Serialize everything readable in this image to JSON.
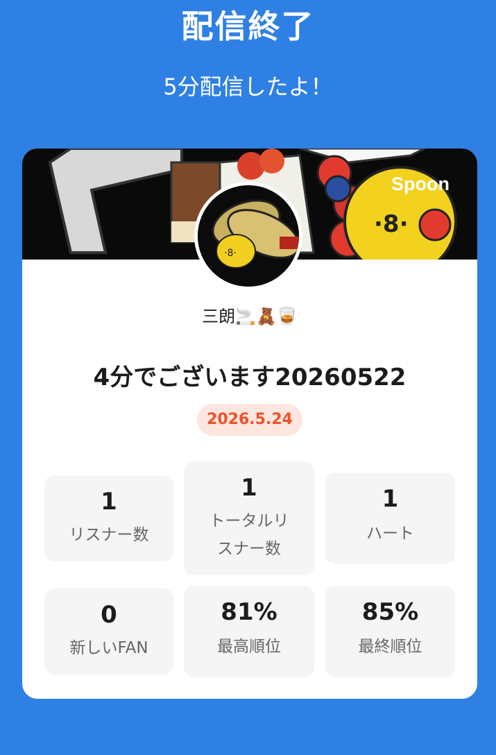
{
  "header": {
    "title": "配信終了",
    "subtitle": "5分配信したよ！"
  },
  "card": {
    "brand_logo": "Spoon",
    "username": "三朗🚬🧸🥃",
    "stream_title": "4分でございます20260522",
    "date": "2026.5.24",
    "stats": [
      {
        "value": "1",
        "label": "リスナー数"
      },
      {
        "value": "1",
        "label_line1": "トータルリ",
        "label_line2": "スナー数"
      },
      {
        "value": "1",
        "label": "ハート"
      },
      {
        "value": "0",
        "label": "新しいFAN"
      },
      {
        "value": "81%",
        "label": "最高順位"
      },
      {
        "value": "85%",
        "label": "最終順位"
      }
    ]
  },
  "colors": {
    "background": "#2f80e4",
    "card": "#ffffff",
    "date_badge_bg": "#fde6df",
    "date_badge_text": "#ef5228",
    "stat_bg": "#f5f5f5"
  }
}
